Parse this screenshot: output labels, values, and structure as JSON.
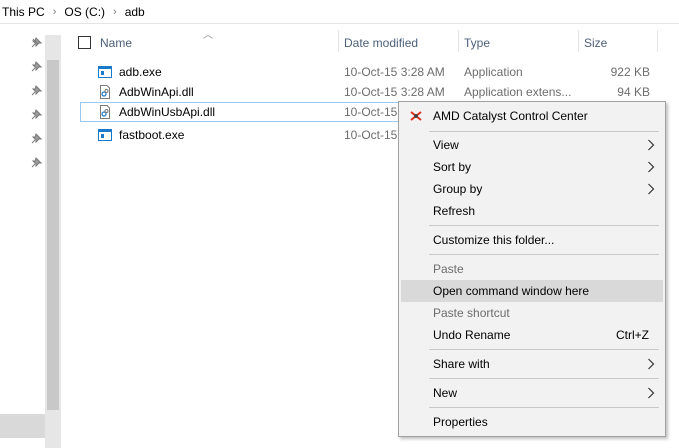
{
  "breadcrumb": {
    "items": [
      "This PC",
      "OS (C:)",
      "adb"
    ]
  },
  "columns": {
    "name": "Name",
    "date": "Date modified",
    "type": "Type",
    "size": "Size"
  },
  "files": [
    {
      "name": "adb.exe",
      "date": "10-Oct-15 3:28 AM",
      "type": "Application",
      "size": "922 KB",
      "icon": "exe-icon"
    },
    {
      "name": "AdbWinApi.dll",
      "date": "10-Oct-15 3:28 AM",
      "type": "Application extens...",
      "size": "94 KB",
      "icon": "dll-icon"
    },
    {
      "name": "AdbWinUsbApi.dll",
      "date": "10-Oct-15",
      "type": "",
      "size": "",
      "icon": "dll-icon"
    },
    {
      "name": "fastboot.exe",
      "date": "10-Oct-15",
      "type": "",
      "size": "",
      "icon": "exe-icon"
    }
  ],
  "menu": {
    "amd": "AMD Catalyst Control Center",
    "view": "View",
    "sort_by": "Sort by",
    "group_by": "Group by",
    "refresh": "Refresh",
    "customize": "Customize this folder...",
    "paste": "Paste",
    "open_cmd": "Open command window here",
    "paste_shortcut": "Paste shortcut",
    "undo_rename": "Undo Rename",
    "undo_shortcut": "Ctrl+Z",
    "share_with": "Share with",
    "new": "New",
    "properties": "Properties"
  },
  "colors": {
    "accent_blue": "#1979ca",
    "highlight": "#d9d9d9",
    "selection_border": "#99c9ef",
    "amd_red": "#e0301e"
  }
}
